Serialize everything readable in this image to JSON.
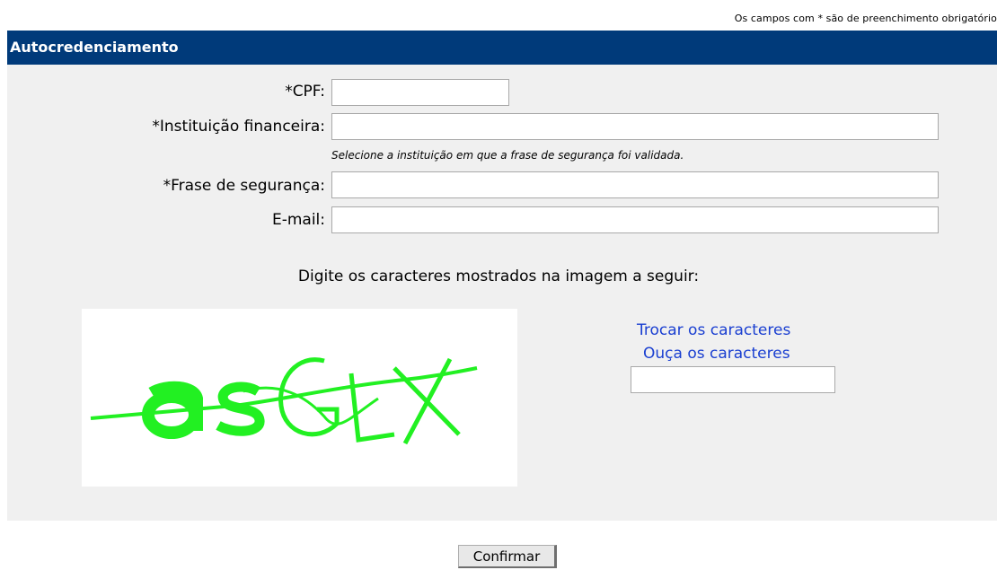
{
  "required_note": "Os campos com * são de preenchimento obrigatório",
  "panel": {
    "title": "Autocredenciamento"
  },
  "form": {
    "cpf_label": "*CPF:",
    "cpf_value": "",
    "instituicao_label": "*Instituição financeira:",
    "instituicao_value": "",
    "instituicao_hint": "Selecione a instituição em que a frase de segurança foi validada.",
    "frase_label": "*Frase de segurança:",
    "frase_value": "",
    "email_label": "E-mail:",
    "email_value": ""
  },
  "captcha": {
    "instruction": "Digite os caracteres mostrados na imagem a seguir:",
    "image_text": "asGLX",
    "image_color": "#22f022",
    "refresh_link": "Trocar os caracteres",
    "audio_link": "Ouça os caracteres",
    "input_value": ""
  },
  "actions": {
    "confirm_label": "Confirmar"
  },
  "colors": {
    "header_bg": "#003a7a",
    "panel_bg": "#f0f0f0",
    "link": "#1a3fd1"
  }
}
